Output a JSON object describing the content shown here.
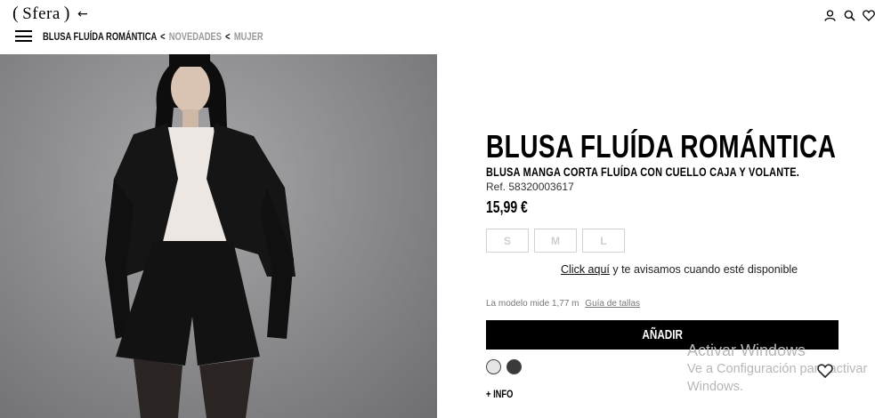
{
  "header": {
    "logo_text": "Sfera",
    "logo_paren_open": "(",
    "logo_paren_close": ")",
    "back_arrow": "←",
    "icons": [
      "user-icon",
      "search-icon",
      "heart-icon"
    ]
  },
  "breadcrumb": {
    "current": "BLUSA FLUÍDA ROMÁNTICA",
    "separator": "<",
    "items": [
      "NOVEDADES",
      "MUJER"
    ]
  },
  "product": {
    "name": "BLUSA FLUÍDA ROMÁNTICA",
    "description": "BLUSA MANGA CORTA FLUÍDA CON CUELLO CAJA Y VOLANTE.",
    "reference": "Ref. 58320003617",
    "price": "15,99 €",
    "sizes": [
      "S",
      "M",
      "L"
    ],
    "notify_link": "Click aquí",
    "notify_text": " y te avisamos cuando esté disponible",
    "model_info": "La modelo mide 1,77 m",
    "size_guide": "Guía de tallas",
    "add_button": "AÑADIR",
    "colors": [
      "#e6e6e6",
      "#3a3a3a"
    ],
    "info_label": "+ INFO"
  },
  "watermark": {
    "line1": "Activar Windows",
    "line2": "Ve a Configuración para activar",
    "line3": "Windows."
  }
}
